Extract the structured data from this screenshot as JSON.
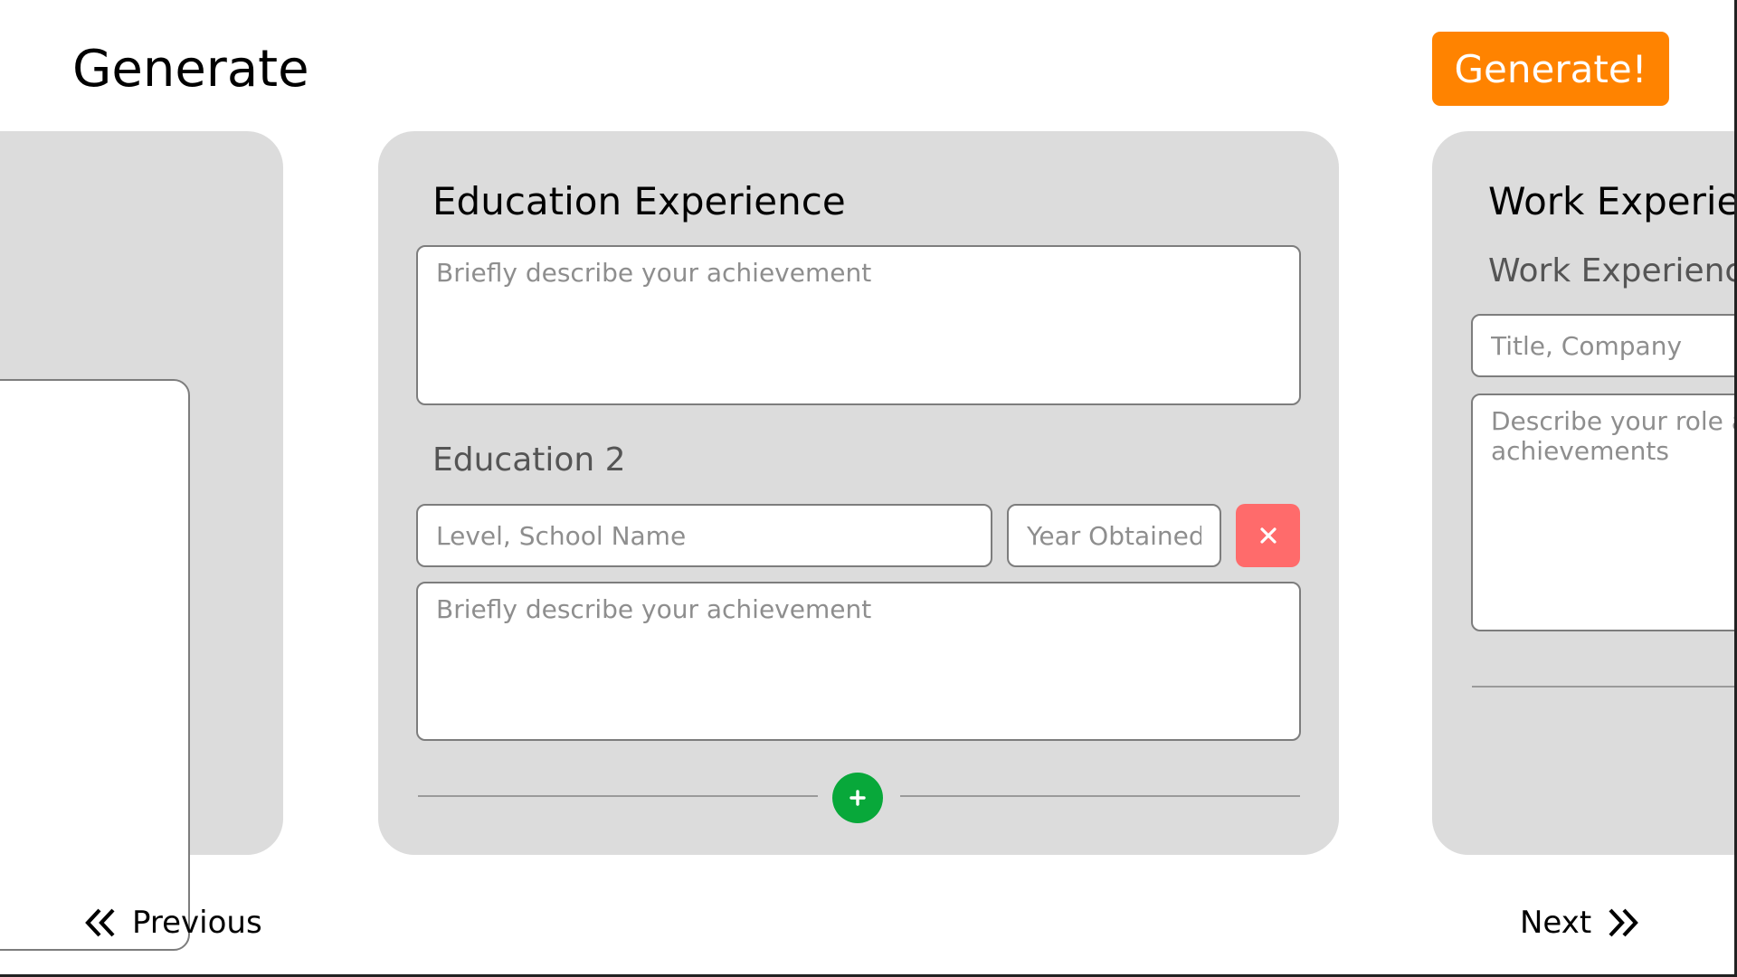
{
  "header": {
    "title": "Generate",
    "generate_label": "Generate!"
  },
  "left_card": {},
  "education": {
    "title": "Education Experience",
    "achievement_placeholder_1": "Briefly describe your achievement",
    "entry_2_label": "Education 2",
    "school_placeholder": "Level, School Name",
    "year_placeholder": "Year Obtained",
    "achievement_placeholder_2": "Briefly describe your achievement",
    "delete_icon": "close-icon",
    "add_icon": "plus-icon"
  },
  "work": {
    "title": "Work Experience",
    "entry_label": "Work Experience",
    "title_placeholder": "Title, Company",
    "role_placeholder": "Describe your role and achievements"
  },
  "nav": {
    "previous_label": "Previous",
    "next_label": "Next"
  },
  "colors": {
    "accent_orange": "#ff8300",
    "delete_red": "#ff6b6b",
    "add_green": "#08a83a",
    "card_gray": "#dcdcdc"
  }
}
